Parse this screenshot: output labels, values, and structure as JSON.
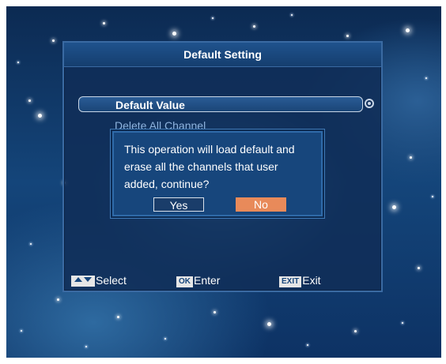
{
  "panel": {
    "title": "Default Setting",
    "items": [
      {
        "label": "Default Value"
      },
      {
        "label": "Delete All Channel"
      }
    ]
  },
  "dialog": {
    "message": "This operation will load default and\nerase all the channels that user\nadded, continue?",
    "yes_label": "Yes",
    "no_label": "No"
  },
  "footer": {
    "select": {
      "key_icon": "up-down-arrow-icon",
      "label": "Select"
    },
    "enter": {
      "key": "OK",
      "label": "Enter"
    },
    "exit": {
      "key": "EXIT",
      "label": "Exit"
    }
  },
  "colors": {
    "panel_bg": "#102e58",
    "dialog_bg": "#17467c",
    "no_button": "#e88a5a",
    "inactive_item": "#8fb4df"
  }
}
